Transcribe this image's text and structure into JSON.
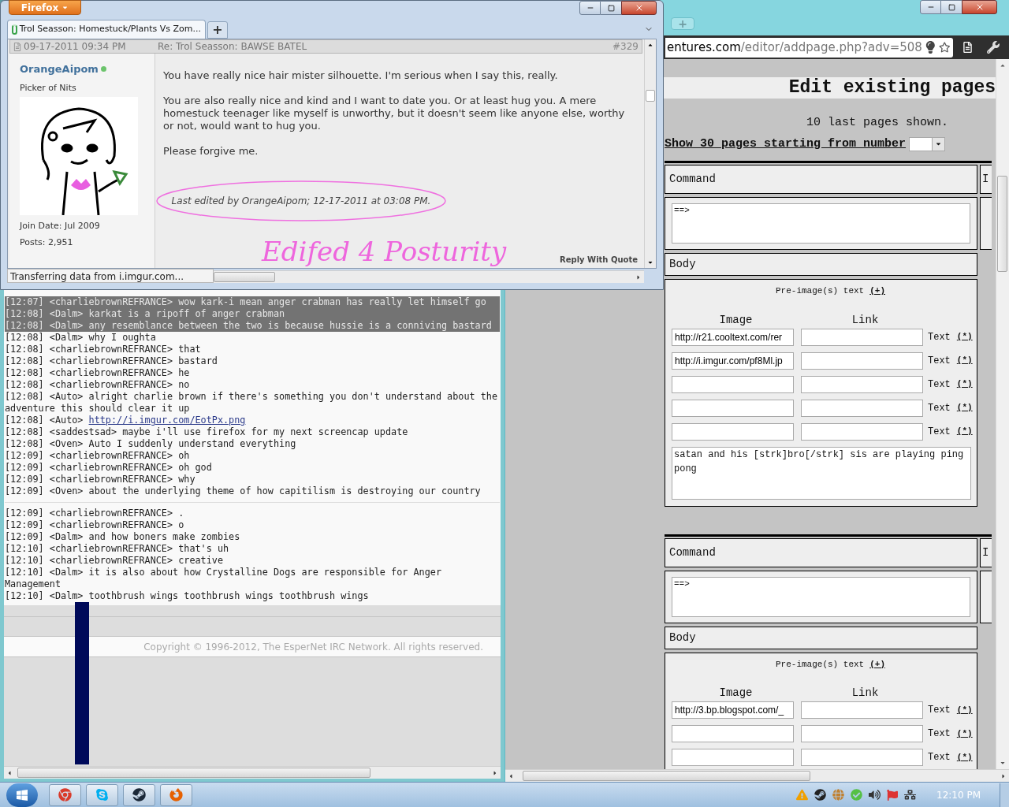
{
  "firefox_window": {
    "menu_button": "Firefox",
    "tabs": [
      {
        "title": "Trol Seasson: Homestuck/Plants Vs Zom...",
        "selected": true,
        "loading": true
      }
    ],
    "new_tab": "+",
    "post": {
      "date": "09-17-2011 09:34 PM",
      "subject": "Re: Trol Seasson: BAWSE BATEL",
      "number": "#329",
      "author": "OrangeAipom",
      "online": true,
      "user_title": "Picker of Nits",
      "join_date": "Join Date:  Jul 2009",
      "posts": "Posts:  2,951",
      "paragraphs": [
        "You have really nice hair mister silhouette. I'm serious when I say this, really.",
        "You are also really nice and kind and I want to date you. Or at least hug you. A mere homestuck teenager like myself is unworthy, but it doesn't seem like anyone else, worthy or not, would want to hug you.",
        "Please forgive me."
      ],
      "edit_note": "Last edited by OrangeAipom; 12-17-2011 at 03:08 PM.",
      "handwriting": "Edifed 4 Posturity",
      "reply_button": "Reply With Quote"
    },
    "status": "Transferring data from i.imgur.com..."
  },
  "irc_window": {
    "blocks": [
      [
        {
          "time": "[12:07]",
          "nick": "<charliebrownREFRANCE>",
          "text": "wow kark-i mean anger crabman has really let himself go",
          "selected": true
        },
        {
          "time": "[12:08]",
          "nick": "<Dalm>",
          "text": "karkat is a ripoff of anger crabman",
          "selected": true
        },
        {
          "time": "[12:08]",
          "nick": "<Dalm>",
          "text": "any resemblance between the two is because hussie is a conniving bastard",
          "selected": true
        },
        {
          "time": "[12:08]",
          "nick": "<Dalm>",
          "text": "why I oughta",
          "selected": false
        },
        {
          "time": "[12:08]",
          "nick": "<charliebrownREFRANCE>",
          "text": "that",
          "selected": false
        },
        {
          "time": "[12:08]",
          "nick": "<charliebrownREFRANCE>",
          "text": "bastard",
          "selected": false
        },
        {
          "time": "[12:08]",
          "nick": "<charliebrownREFRANCE>",
          "text": "he",
          "selected": false
        },
        {
          "time": "[12:08]",
          "nick": "<charliebrownREFRANCE>",
          "text": "no",
          "selected": false
        },
        {
          "time": "[12:08]",
          "nick": "<Auto>",
          "text": "alright charlie brown if there's something you don't understand about the adventure this should clear it up",
          "selected": false
        },
        {
          "time": "[12:08]",
          "nick": "<Auto>",
          "link": "http://i.imgur.com/EotPx.png",
          "selected": false
        },
        {
          "time": "[12:08]",
          "nick": "<saddestsad>",
          "text": "maybe i'll use firefox for my next screencap update",
          "selected": false
        },
        {
          "time": "[12:08]",
          "nick": "<Oven>",
          "text": "Auto I suddenly understand everything",
          "selected": false
        },
        {
          "time": "[12:09]",
          "nick": "<charliebrownREFRANCE>",
          "text": "oh",
          "selected": false
        },
        {
          "time": "[12:09]",
          "nick": "<charliebrownREFRANCE>",
          "text": "oh god",
          "selected": false
        },
        {
          "time": "[12:09]",
          "nick": "<charliebrownREFRANCE>",
          "text": "why",
          "selected": false
        },
        {
          "time": "[12:09]",
          "nick": "<Oven>",
          "text": "about the underlying theme of how capitilism is destroying our country",
          "selected": false
        }
      ],
      [
        {
          "time": "[12:09]",
          "nick": "<charliebrownREFRANCE>",
          "text": ".",
          "selected": false
        },
        {
          "time": "[12:09]",
          "nick": "<charliebrownREFRANCE>",
          "text": "o",
          "selected": false
        },
        {
          "time": "[12:09]",
          "nick": "<Dalm>",
          "text": "and how boners make zombies",
          "selected": false
        },
        {
          "time": "[12:10]",
          "nick": "<charliebrownREFRANCE>",
          "text": "that's uh",
          "selected": false
        },
        {
          "time": "[12:10]",
          "nick": "<charliebrownREFRANCE>",
          "text": "creative",
          "selected": false
        },
        {
          "time": "[12:10]",
          "nick": "<Dalm>",
          "text": "it is also about how Crystalline Dogs are responsible for Anger Management",
          "selected": false
        },
        {
          "time": "[12:10]",
          "nick": "<Dalm>",
          "text": "toothbrush wings toothbrush wings toothbrush wings",
          "selected": false
        }
      ]
    ],
    "footer": "Copyright © 1996-2012, The EsperNet IRC Network. All rights reserved."
  },
  "chrome_window": {
    "new_tab": "+",
    "url_host": "entures.com",
    "url_path": "/editor/addpage.php?adv=508",
    "page": {
      "heading": "Edit existing pages",
      "shown_note": "10 last pages shown.",
      "show_link": "Show 30 pages starting from number",
      "entries": [
        {
          "command_label": "Command",
          "side_header": "I",
          "command_value": "==>",
          "body_label": "Body",
          "pre_image_label": "Pre-image(s) text",
          "add_link": "(+)",
          "image_header": "Image",
          "link_header": "Link",
          "rows": [
            {
              "image": "http://r21.cooltext.com/rer",
              "text_label": "Text",
              "action": "(*)"
            },
            {
              "image": "http://i.imgur.com/pf8Ml.jp",
              "text_label": "Text",
              "action": "(*)"
            },
            {
              "text_label": "Text",
              "action": "(*)"
            },
            {
              "text_label": "Text",
              "action": "(*)"
            },
            {
              "text_label": "Text",
              "action": "(*)"
            }
          ],
          "body_text": "satan and his [strk]bro[/strk] sis are playing ping pong"
        },
        {
          "command_label": "Command",
          "side_header": "I",
          "command_value": "==>",
          "body_label": "Body",
          "pre_image_label": "Pre-image(s) text",
          "add_link": "(+)",
          "image_header": "Image",
          "link_header": "Link",
          "rows": [
            {
              "image": "http://3.bp.blogspot.com/_",
              "text_label": "Text",
              "action": "(*)"
            },
            {
              "text_label": "Text",
              "action": "(*)"
            },
            {
              "text_label": "Text",
              "action": "(*)"
            }
          ]
        }
      ]
    }
  },
  "taskbar": {
    "apps": [
      {
        "kind": "chrome"
      },
      {
        "kind": "skype"
      },
      {
        "kind": "steam"
      },
      {
        "kind": "firefox"
      }
    ],
    "clock": "12:10 PM"
  }
}
